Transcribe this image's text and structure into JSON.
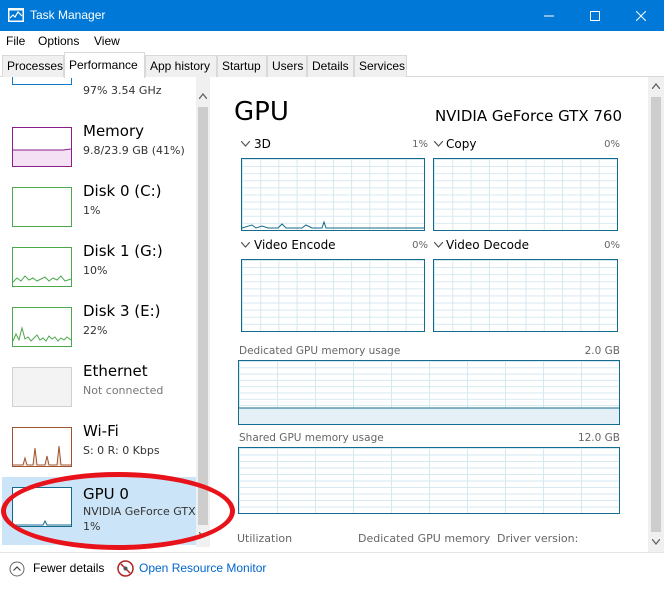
{
  "window": {
    "title": "Task Manager",
    "controls": [
      "minimize",
      "maximize",
      "close"
    ]
  },
  "menu": [
    "File",
    "Options",
    "View"
  ],
  "tabs": [
    "Processes",
    "Performance",
    "App history",
    "Startup",
    "Users",
    "Details",
    "Services"
  ],
  "active_tab": "Performance",
  "sidebar": {
    "cpu_partial": "97%  3.54 GHz",
    "items": [
      {
        "name": "Memory",
        "sub": "9.8/23.9 GB (41%)",
        "color": "#8b1e8b"
      },
      {
        "name": "Disk 0 (C:)",
        "sub": "1%",
        "color": "#4ca84c"
      },
      {
        "name": "Disk 1 (G:)",
        "sub": "10%",
        "color": "#4ca84c"
      },
      {
        "name": "Disk 3 (E:)",
        "sub": "22%",
        "color": "#4ca84c"
      },
      {
        "name": "Ethernet",
        "sub": "Not connected",
        "color": "#a0a0a0"
      },
      {
        "name": "Wi-Fi",
        "sub": "S: 0  R: 0 Kbps",
        "color": "#a0522d"
      },
      {
        "name": "GPU 0",
        "sub": "NVIDIA GeForce GTX",
        "sub2": "1%",
        "color": "#136b8e"
      }
    ]
  },
  "panel": {
    "title": "GPU",
    "model": "NVIDIA GeForce GTX 760",
    "engines": [
      {
        "label": "3D",
        "pct": "1%"
      },
      {
        "label": "Copy",
        "pct": "0%"
      },
      {
        "label": "Video Encode",
        "pct": "0%"
      },
      {
        "label": "Video Decode",
        "pct": "0%"
      }
    ],
    "dedicated": {
      "label": "Dedicated GPU memory usage",
      "max": "2.0 GB"
    },
    "shared": {
      "label": "Shared GPU memory usage",
      "max": "12.0 GB"
    },
    "bottom": [
      "Utilization",
      "Dedicated GPU memory",
      "Driver version:"
    ]
  },
  "footer": {
    "fewer_details": "Fewer details",
    "open_resource_monitor": "Open Resource Monitor"
  },
  "colors": {
    "accent": "#0078d7",
    "gpu": "#136b8e",
    "annotation": "#e8121a"
  }
}
